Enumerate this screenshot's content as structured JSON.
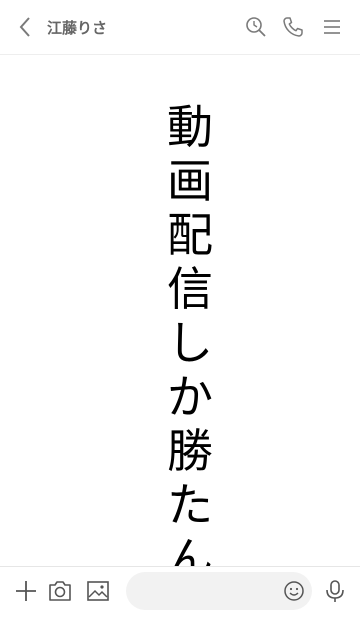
{
  "header": {
    "title": "江藤りさ"
  },
  "main": {
    "characters": [
      "動",
      "画",
      "配",
      "信",
      "し",
      "か",
      "勝",
      "た",
      "ん"
    ]
  },
  "footer": {
    "message_placeholder": ""
  },
  "colors": {
    "icon": "#7a7a7a",
    "text": "#000000",
    "title": "#666666"
  }
}
